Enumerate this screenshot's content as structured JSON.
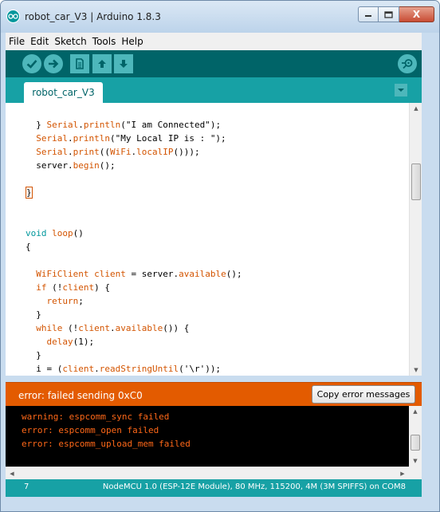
{
  "window": {
    "title": "robot_car_V3 | Arduino 1.8.3",
    "minimize_icon": "minimize-icon",
    "maximize_icon": "maximize-icon",
    "close_label": "X"
  },
  "menubar": {
    "items": [
      "File",
      "Edit",
      "Sketch",
      "Tools",
      "Help"
    ]
  },
  "toolbar": {
    "buttons": [
      "verify-icon",
      "upload-icon",
      "new-icon",
      "open-icon",
      "save-icon"
    ],
    "right_button": "serial-monitor-icon"
  },
  "tabs": {
    "active": "robot_car_V3",
    "menu_icon": "tab-menu-icon"
  },
  "editor": {
    "lines": [
      {
        "segments": [
          {
            "t": "  } ",
            "c": ""
          },
          {
            "t": "Serial",
            "c": "kw-orange"
          },
          {
            "t": ".",
            "c": ""
          },
          {
            "t": "println",
            "c": "kw-orange"
          },
          {
            "t": "(\"I am Connected\");",
            "c": ""
          }
        ]
      },
      {
        "segments": [
          {
            "t": "  ",
            "c": ""
          },
          {
            "t": "Serial",
            "c": "kw-orange"
          },
          {
            "t": ".",
            "c": ""
          },
          {
            "t": "println",
            "c": "kw-orange"
          },
          {
            "t": "(\"My Local IP is : \");",
            "c": ""
          }
        ]
      },
      {
        "segments": [
          {
            "t": "  ",
            "c": ""
          },
          {
            "t": "Serial",
            "c": "kw-orange"
          },
          {
            "t": ".",
            "c": ""
          },
          {
            "t": "print",
            "c": "kw-orange"
          },
          {
            "t": "((",
            "c": ""
          },
          {
            "t": "WiFi",
            "c": "kw-orange"
          },
          {
            "t": ".",
            "c": ""
          },
          {
            "t": "localIP",
            "c": "kw-orange"
          },
          {
            "t": "()));",
            "c": ""
          }
        ]
      },
      {
        "segments": [
          {
            "t": "  server.",
            "c": ""
          },
          {
            "t": "begin",
            "c": "kw-orange"
          },
          {
            "t": "();",
            "c": ""
          }
        ]
      },
      {
        "segments": [
          {
            "t": "",
            "c": ""
          }
        ]
      },
      {
        "segments": [
          {
            "t": "}",
            "c": "brace-hl"
          }
        ]
      },
      {
        "segments": [
          {
            "t": "",
            "c": ""
          }
        ]
      },
      {
        "segments": [
          {
            "t": "",
            "c": ""
          }
        ]
      },
      {
        "segments": [
          {
            "t": "void",
            "c": "kw-teal"
          },
          {
            "t": " ",
            "c": ""
          },
          {
            "t": "loop",
            "c": "kw-orange"
          },
          {
            "t": "()",
            "c": ""
          }
        ]
      },
      {
        "segments": [
          {
            "t": "{",
            "c": ""
          }
        ]
      },
      {
        "segments": [
          {
            "t": "",
            "c": ""
          }
        ]
      },
      {
        "segments": [
          {
            "t": "  ",
            "c": ""
          },
          {
            "t": "WiFiClient",
            "c": "kw-orange"
          },
          {
            "t": " ",
            "c": ""
          },
          {
            "t": "client",
            "c": "kw-orange"
          },
          {
            "t": " = server.",
            "c": ""
          },
          {
            "t": "available",
            "c": "kw-orange"
          },
          {
            "t": "();",
            "c": ""
          }
        ]
      },
      {
        "segments": [
          {
            "t": "  ",
            "c": ""
          },
          {
            "t": "if",
            "c": "kw-orange"
          },
          {
            "t": " (!",
            "c": ""
          },
          {
            "t": "client",
            "c": "kw-orange"
          },
          {
            "t": ") {",
            "c": ""
          }
        ]
      },
      {
        "segments": [
          {
            "t": "    ",
            "c": ""
          },
          {
            "t": "return",
            "c": "kw-orange"
          },
          {
            "t": ";",
            "c": ""
          }
        ]
      },
      {
        "segments": [
          {
            "t": "  }",
            "c": ""
          }
        ]
      },
      {
        "segments": [
          {
            "t": "  ",
            "c": ""
          },
          {
            "t": "while",
            "c": "kw-orange"
          },
          {
            "t": " (!",
            "c": ""
          },
          {
            "t": "client",
            "c": "kw-orange"
          },
          {
            "t": ".",
            "c": ""
          },
          {
            "t": "available",
            "c": "kw-orange"
          },
          {
            "t": "()) {",
            "c": ""
          }
        ]
      },
      {
        "segments": [
          {
            "t": "    ",
            "c": ""
          },
          {
            "t": "delay",
            "c": "kw-orange"
          },
          {
            "t": "(1);",
            "c": ""
          }
        ]
      },
      {
        "segments": [
          {
            "t": "  }",
            "c": ""
          }
        ]
      },
      {
        "segments": [
          {
            "t": "  i = (",
            "c": ""
          },
          {
            "t": "client",
            "c": "kw-orange"
          },
          {
            "t": ".",
            "c": ""
          },
          {
            "t": "readStringUntil",
            "c": "kw-orange"
          },
          {
            "t": "('\\r'));",
            "c": ""
          }
        ]
      }
    ]
  },
  "status": {
    "message": "error: failed sending 0xC0",
    "copy_button": "Copy error messages"
  },
  "console": {
    "lines": [
      "warning: espcomm_sync failed",
      "error: espcomm_open failed",
      "error: espcomm_upload_mem failed"
    ]
  },
  "footer": {
    "line_number": "7",
    "board": "NodeMCU 1.0 (ESP-12E Module), 80 MHz, 115200, 4M (3M SPIFFS) on COM8"
  },
  "colors": {
    "teal_dark": "#006468",
    "teal": "#17a1a5",
    "error_orange": "#e35b00",
    "console_text": "#ff6818"
  }
}
